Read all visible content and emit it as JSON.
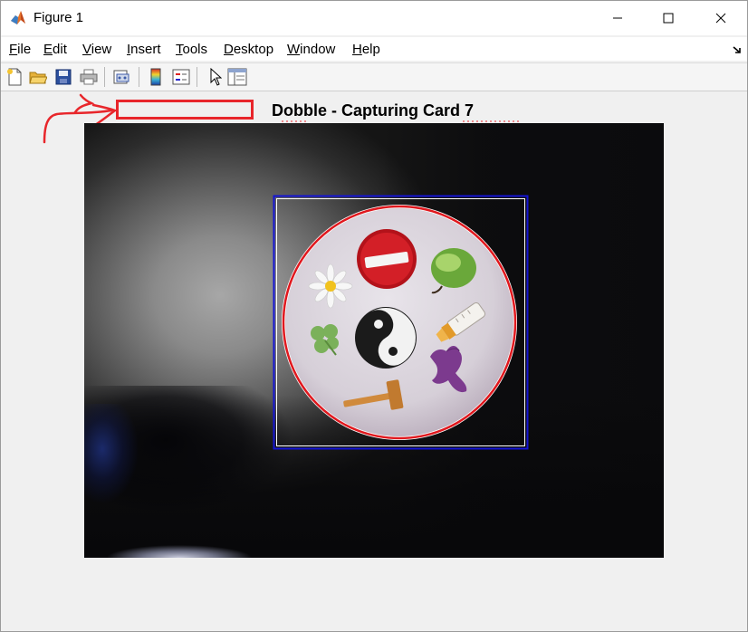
{
  "window": {
    "title": "Figure 1"
  },
  "menu": {
    "items": [
      {
        "label": "File",
        "accel": "F",
        "rest": "ile"
      },
      {
        "label": "Edit",
        "accel": "E",
        "rest": "dit"
      },
      {
        "label": "View",
        "accel": "V",
        "rest": "iew"
      },
      {
        "label": "Insert",
        "accel": "I",
        "rest": "nsert"
      },
      {
        "label": "Tools",
        "accel": "T",
        "rest": "ools"
      },
      {
        "label": "Desktop",
        "accel": "D",
        "rest": "esktop"
      },
      {
        "label": "Window",
        "accel": "W",
        "rest": "indow"
      },
      {
        "label": "Help",
        "accel": "H",
        "rest": "elp"
      }
    ]
  },
  "toolbar": {
    "icons": [
      "new-figure-icon",
      "open-file-icon",
      "save-icon",
      "print-icon",
      "link-plot-icon",
      "colorbar-icon",
      "legend-icon",
      "pointer-icon",
      "property-inspector-icon"
    ]
  },
  "figure": {
    "title": "Dobble - Capturing Card 7"
  },
  "card": {
    "symbols": [
      "stop-sign",
      "apple",
      "daisy",
      "baby-bottle",
      "clover",
      "yin-yang",
      "dragon",
      "hammer"
    ]
  },
  "colors": {
    "bounding_box": "#1414d4",
    "circle": "#e0181e",
    "annotation": "#e8262b"
  }
}
